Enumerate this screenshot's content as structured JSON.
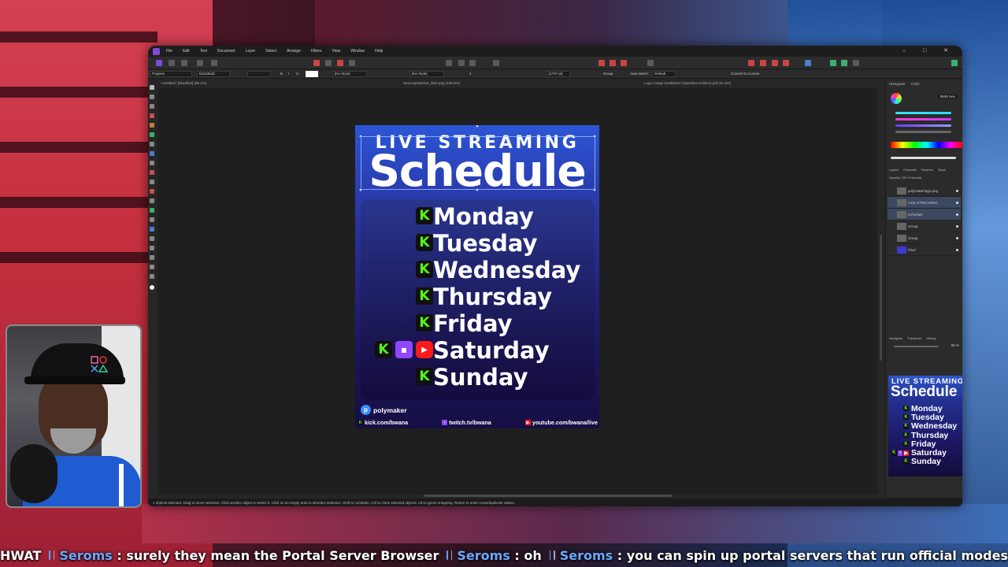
{
  "menu": {
    "items": [
      "File",
      "Edit",
      "Text",
      "Document",
      "Layer",
      "Select",
      "Arrange",
      "Filters",
      "View",
      "Window",
      "Help"
    ]
  },
  "context_toolbar": {
    "font": "Poppins",
    "weight": "ExtraBold",
    "bold": "B",
    "italic": "I",
    "underline": "U",
    "char_style": "[No Style]",
    "para_style": "[No Style]",
    "size": "1",
    "pt_value": "[1757 pt]",
    "group": "Group",
    "auto_select": "Auto-select:",
    "auto_select_value": "Default",
    "convert_to_curves": "Convert to Curves"
  },
  "document_tabs": [
    "<Untitled> [Modified] (95.1%)",
    "Newcapsalarbar_dark.png (168.6%)",
    "Logo Usage Guidelines (Speedrun Edition).pdf (21.8%)"
  ],
  "status_bar": {
    "text": "1 objects selected. Drag to move selection. Click another object to select it. Click on an empty area to deselect selection. Shift to constrain. Ctrl to clone selected objects. Alt to ignore snapping. Return to enter move/duplicate values."
  },
  "right_panel": {
    "tabs": [
      "Histogram",
      "Color"
    ],
    "hex_value": "9848 Hex",
    "layer_tabs": [
      "Layers",
      "Channels",
      "Brushes",
      "Stock"
    ],
    "layer_opts": "Opacity: 100 %   Normal",
    "layers": [
      {
        "name": "polymakerlogo.png",
        "selected": false
      },
      {
        "name": "LIVE STREAMING",
        "selected": true
      },
      {
        "name": "Schedule",
        "selected": true
      },
      {
        "name": "Group",
        "selected": false
      },
      {
        "name": "Group",
        "selected": false
      },
      {
        "name": "Pixel",
        "selected": false
      }
    ],
    "nav_tabs": [
      "Navigator",
      "Transform",
      "History"
    ],
    "zoom": "95 %"
  },
  "artwork": {
    "title_line1": "LIVE STREAMING",
    "title_line2": "Schedule",
    "days": [
      {
        "label": "Monday",
        "platforms": [
          "kick"
        ]
      },
      {
        "label": "Tuesday",
        "platforms": [
          "kick"
        ]
      },
      {
        "label": "Wednesday",
        "platforms": [
          "kick"
        ]
      },
      {
        "label": "Thursday",
        "platforms": [
          "kick"
        ]
      },
      {
        "label": "Friday",
        "platforms": [
          "kick"
        ]
      },
      {
        "label": "Saturday",
        "platforms": [
          "kick",
          "twitch",
          "youtube"
        ]
      },
      {
        "label": "Sunday",
        "platforms": [
          "kick"
        ]
      }
    ],
    "brand": "polymaker",
    "links": {
      "kick": "kick.com/bwana",
      "twitch": "twitch.tv/bwana",
      "youtube": "youtube.com/bwana/live"
    },
    "colors": {
      "kick": "#53fc18",
      "twitch": "#9146ff",
      "youtube": "#ff1a1a"
    }
  },
  "chat_ticker": {
    "leading": "HWAT",
    "messages": [
      {
        "user": "Seroms",
        "text": "surely they mean the Portal Server Browser"
      },
      {
        "user": "Seroms",
        "text": "oh"
      },
      {
        "user": "Seroms",
        "text": "you can spin up portal servers that run official modes"
      }
    ]
  }
}
